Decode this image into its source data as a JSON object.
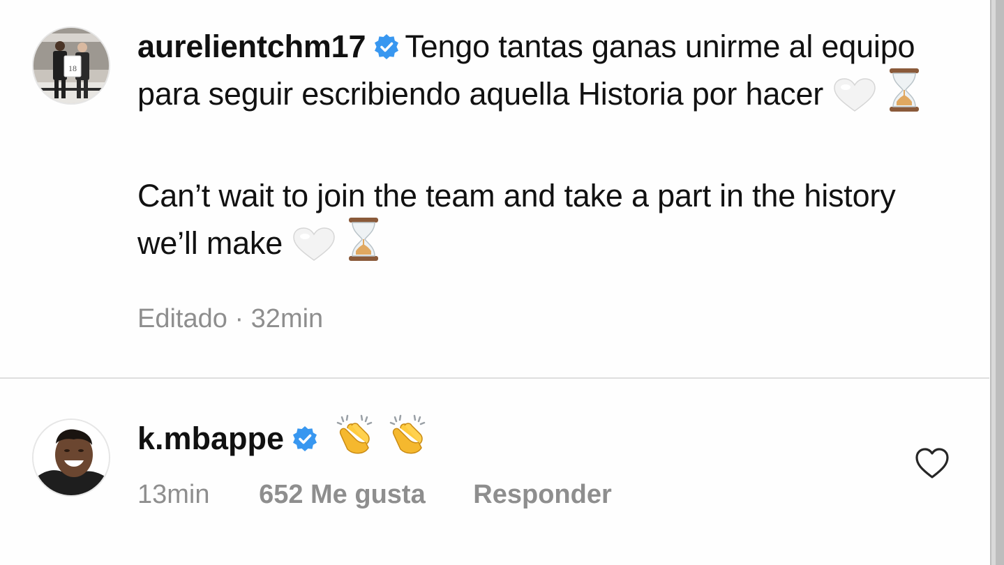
{
  "caption": {
    "username": "aurelientchm17",
    "verified_icon": "verified-badge-icon",
    "text_es": "Tengo tantas ganas unirme al equipo para seguir escribiendo aquella Historia por hacer",
    "text_en": "Can’t wait to join the team and take a part in the history we’ll make",
    "emojis": [
      "white-heart-icon",
      "hourglass-icon"
    ],
    "edited_label": "Editado",
    "separator": "·",
    "time": "32min"
  },
  "comment": {
    "username": "k.mbappe",
    "verified_icon": "verified-badge-icon",
    "emojis": [
      "clapping-hands-icon",
      "clapping-hands-icon"
    ],
    "time": "13min",
    "likes": "652 Me gusta",
    "reply_label": "Responder",
    "like_icon": "heart-outline-icon"
  },
  "colors": {
    "text": "#111111",
    "secondary": "#8e8e8e",
    "verified_blue": "#3897f0",
    "divider": "#dedede"
  }
}
